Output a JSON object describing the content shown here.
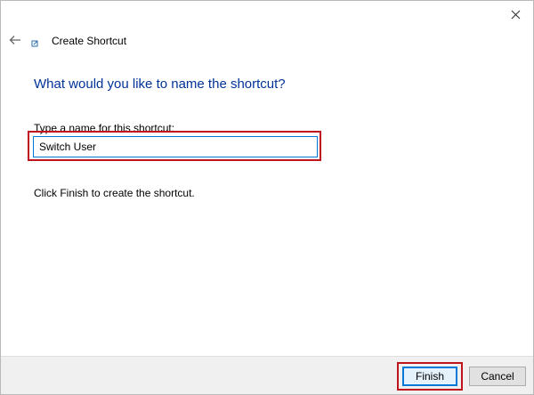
{
  "window": {
    "title": "Create Shortcut",
    "close_symbol": "✕"
  },
  "icons": {
    "back": "back-arrow-icon",
    "app": "shortcut-app-icon",
    "close": "close-icon"
  },
  "main": {
    "heading": "What would you like to name the shortcut?",
    "field_label": "Type a name for this shortcut:",
    "name_value": "Switch User",
    "hint": "Click Finish to create the shortcut."
  },
  "footer": {
    "finish_label": "Finish",
    "cancel_label": "Cancel"
  },
  "colors": {
    "heading": "#003399",
    "highlight_red": "#c0141c",
    "focus_blue": "#0078d7",
    "footer_bg": "#f0f0f0"
  }
}
